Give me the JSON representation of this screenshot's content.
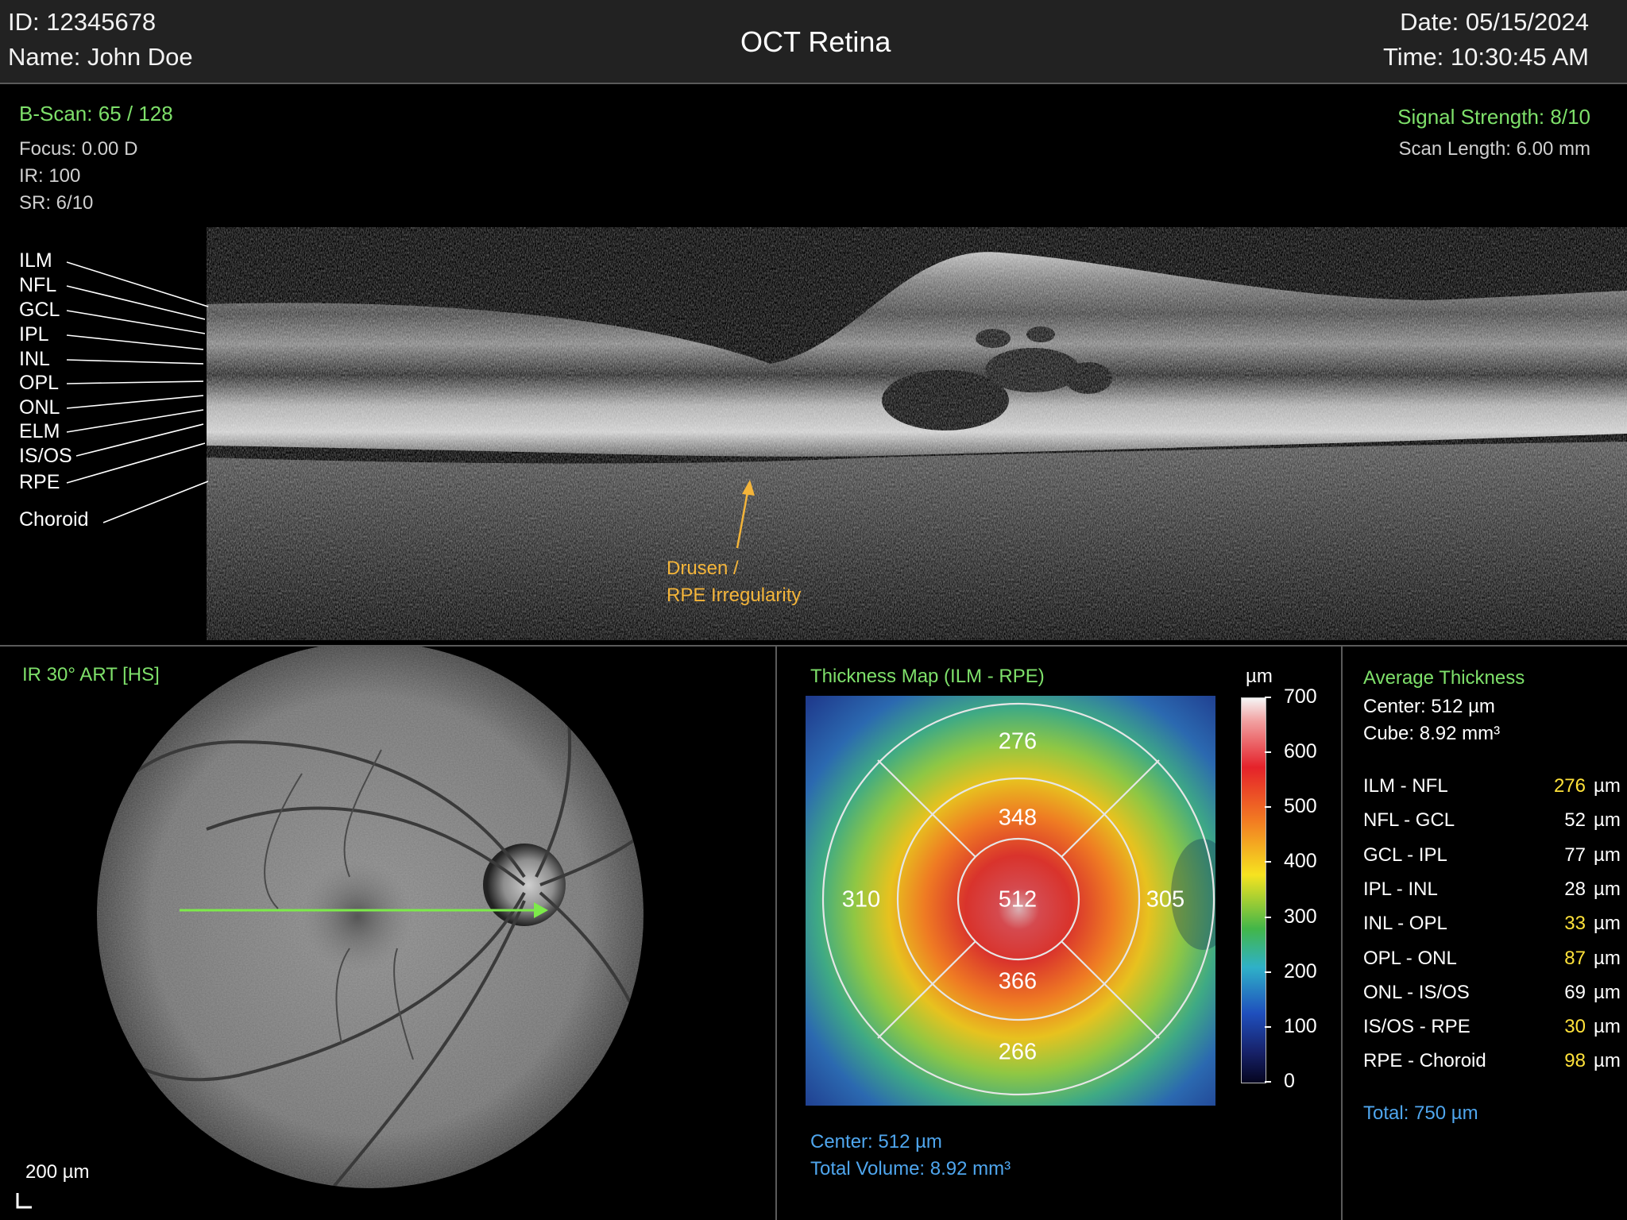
{
  "header": {
    "id_label": "ID:",
    "id_value": "12345678",
    "name_label": "Name:",
    "name_value": "John Doe",
    "title": "OCT Retina",
    "date_label": "Date:",
    "date_value": "05/15/2024",
    "time_label": "Time:",
    "time_value": "10:30:45 AM"
  },
  "bscan": {
    "scan_label": "B-Scan:",
    "scan_value": "65 / 128",
    "focus": "Focus: 0.00 D",
    "ir": "IR: 100",
    "sr": "SR: 6/10",
    "signal_label": "Signal Strength:",
    "signal_value": "8/10",
    "scan_length": "Scan Length: 6.00 mm",
    "layers": [
      "ILM",
      "NFL",
      "GCL",
      "IPL",
      "INL",
      "OPL",
      "ONL",
      "ELM",
      "IS/OS",
      "RPE",
      "Choroid"
    ],
    "annotation_line1": "Drusen /",
    "annotation_line2": "RPE Irregularity"
  },
  "fundus": {
    "title": "IR 30° ART [HS]",
    "scale_bar": "200 µm"
  },
  "thickness_map": {
    "title": "Thickness Map (ILM - RPE)",
    "unit": "µm",
    "sectors": {
      "center": "512",
      "inner_superior": "348",
      "inner_inferior": "366",
      "outer_superior": "276",
      "outer_inferior": "266",
      "outer_nasal": "305",
      "outer_temporal": "310"
    },
    "colorbar_ticks": [
      "700",
      "600",
      "500",
      "400",
      "300",
      "200",
      "100",
      "0"
    ],
    "center_label": "Center:",
    "center_value": "512 µm",
    "volume_label": "Total Volume:",
    "volume_value": "8.92 mm³"
  },
  "avg_thickness": {
    "title": "Average Thickness",
    "center_label": "Center:",
    "center_value": "512 µm",
    "cube_label": "Cube:",
    "cube_value": "8.92 mm³",
    "unit": "µm",
    "rows": [
      {
        "label": "ILM - NFL",
        "value": "276",
        "highlight": true
      },
      {
        "label": "NFL - GCL",
        "value": "52",
        "highlight": false
      },
      {
        "label": "GCL - IPL",
        "value": "77",
        "highlight": false
      },
      {
        "label": "IPL - INL",
        "value": "28",
        "highlight": false
      },
      {
        "label": "INL - OPL",
        "value": "33",
        "highlight": true
      },
      {
        "label": "OPL - ONL",
        "value": "87",
        "highlight": true
      },
      {
        "label": "ONL - IS/OS",
        "value": "69",
        "highlight": false
      },
      {
        "label": "IS/OS - RPE",
        "value": "30",
        "highlight": true
      },
      {
        "label": "RPE - Choroid",
        "value": "98",
        "highlight": true
      }
    ],
    "total_label": "Total:",
    "total_value": "750 µm"
  },
  "colors": {
    "green": "#7ee06a",
    "orange": "#f4b53a",
    "blue": "#4fa6ee",
    "yellow": "#ffe23a",
    "scan_arrow": "#7dea4a"
  }
}
